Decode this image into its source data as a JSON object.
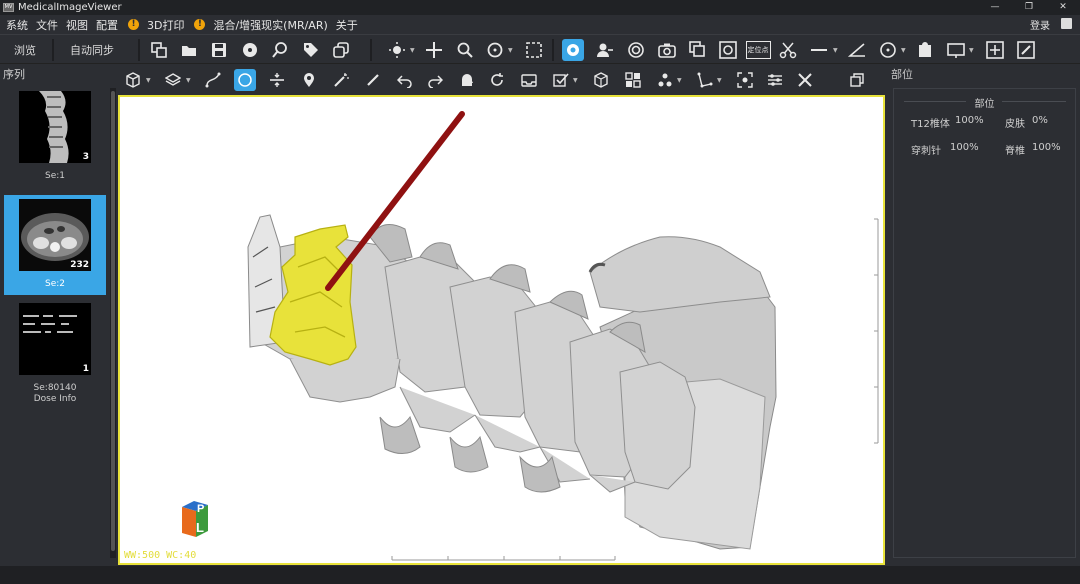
{
  "window": {
    "title": "MedicalImageViewer",
    "controls": [
      "—",
      "❐",
      "✕"
    ]
  },
  "menu": {
    "items": [
      "系统",
      "文件",
      "视图",
      "配置"
    ],
    "print3d": "3D打印",
    "mr_ar": "混合/增强现实(MR/AR)",
    "about": "关于",
    "warn_badge": "!",
    "login": "登录"
  },
  "toolbar": {
    "browse": "浏览",
    "auto_sync": "自动同步",
    "locate_label": "定位点"
  },
  "sequence_panel": {
    "header": "序列",
    "series": [
      {
        "label": "Se:1",
        "sublabel": "",
        "count": "3"
      },
      {
        "label": "Se:2",
        "sublabel": "",
        "count": "232"
      },
      {
        "label": "Se:80140",
        "sublabel": "Dose Info",
        "count": "1"
      }
    ]
  },
  "viewport": {
    "overlay": "WW:500 WC:40",
    "orientation_cube": {
      "front": "L",
      "top": "P"
    },
    "colors": {
      "highlight": "#e8e23a",
      "bone": "#d4d4d4",
      "needle": "#8f1111"
    }
  },
  "right_panel": {
    "header": "部位",
    "group_title": "部位",
    "parts": [
      {
        "name": "T12椎体",
        "value": "100%"
      },
      {
        "name": "皮肤",
        "value": "0%"
      },
      {
        "name": "穿刺针",
        "value": "100%"
      },
      {
        "name": "脊椎",
        "value": "100%"
      }
    ]
  },
  "accent_color": "#3aa6e6"
}
